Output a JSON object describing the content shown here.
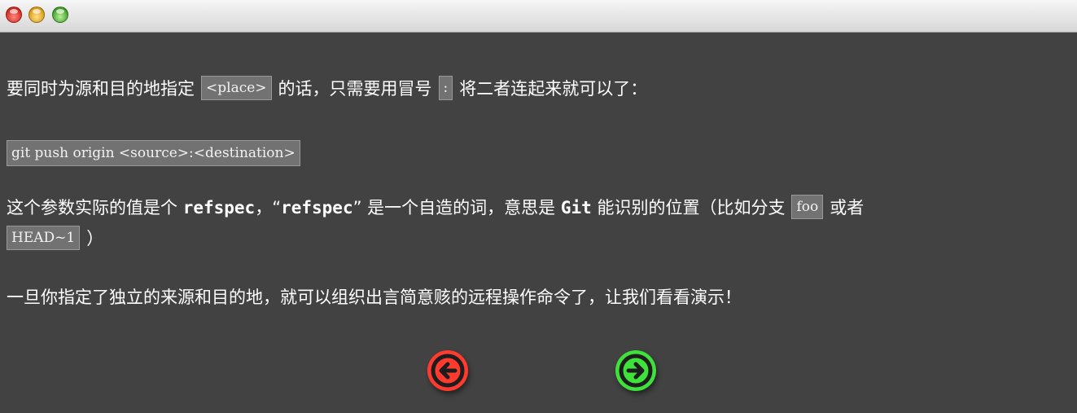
{
  "window": {
    "controls": [
      "close",
      "minimize",
      "zoom"
    ]
  },
  "lesson": {
    "p1": {
      "before": "要同时为源和目的地指定",
      "code1": "<place>",
      "middle": "的话，只需要用冒号",
      "code2": ":",
      "after": "将二者连起来就可以了："
    },
    "command": "git push origin <source>:<destination>",
    "p3": {
      "a": "这个参数实际的值是个",
      "bold1": "refspec",
      "b": "，“",
      "bold2": "refspec",
      "c": "” 是一个自造的词，意思是",
      "bold3": "Git",
      "d": "能识别的位置（比如分支",
      "code1": "foo",
      "e": "或者",
      "code2": "HEAD~1",
      "f": "）"
    },
    "p4": "一旦你指定了独立的来源和目的地，就可以组织出言简意赅的远程操作命令了，让我们看看演示！"
  },
  "nav": {
    "prev_icon": "arrow-left-icon",
    "next_icon": "arrow-right-icon",
    "prev_color": "#ff3b30",
    "next_color": "#3ee23a"
  }
}
